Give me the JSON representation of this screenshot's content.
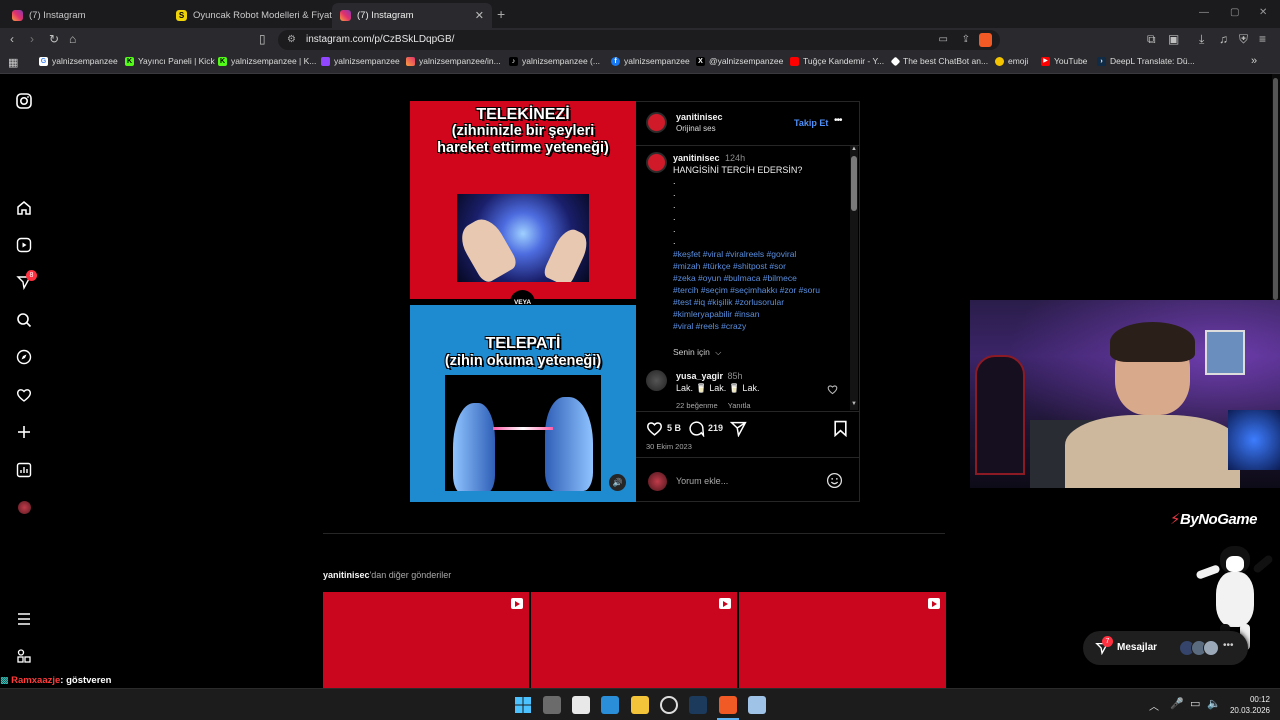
{
  "browser": {
    "tabs": [
      {
        "label": "(7) Instagram",
        "active": false
      },
      {
        "label": "Oyuncak Robot Modelleri & Fiyatları",
        "active": false
      },
      {
        "label": "(7) Instagram",
        "active": true
      }
    ],
    "url": "instagram.com/p/CzBSkLDqpGB/",
    "bookmarks": [
      "yalnizsempanzee",
      "Yayıncı Paneli | Kick",
      "yalnizsempanzee | K...",
      "yalnizsempanzee",
      "yalnizsempanzee/in...",
      "yalnizsempanzee (...",
      "yalnizsempanzee",
      "@yalnizsempanzee",
      "Tuğçe Kandemir - Y...",
      "The best ChatBot an...",
      "emoji",
      "YouTube",
      "DeepL Translate: Dü..."
    ]
  },
  "sidebar": {
    "notification_count": "8"
  },
  "post": {
    "image": {
      "top_title": "TELEKİNEZİ",
      "top_subtitle": "(zihninizle bir şeyleri hareket ettirme yeteneği)",
      "divider": "VEYA",
      "bottom_title": "TELEPATİ",
      "bottom_subtitle": "(zihin okuma yeteneği)"
    },
    "header": {
      "username": "yanitinisec",
      "audio": "Orijinal ses",
      "follow_label": "Takip Et",
      "more": "•••"
    },
    "caption": {
      "username": "yanitinisec",
      "time": "124h",
      "text": "HANGİSİNİ TERCİH EDERSİN?",
      "dots": [
        ".",
        ".",
        ".",
        ".",
        ".",
        "."
      ],
      "hashtags": [
        "#keşfet #viral #viralreels #goviral",
        "#mizah #türkçe #shitpost #sor",
        "#zeka #oyun #bulmaca #bilmece",
        "#tercih #seçim #seçimhakkı #zor #soru",
        "#test #iq #kişilik #zorlusorular",
        "#kimleryapabilir #insan",
        "#viral #reels #crazy"
      ]
    },
    "sort_label": "Senin için",
    "comment": {
      "username": "yusa_yagir",
      "time": "85h",
      "text": "Lak. 🥛 Lak. 🥛 Lak.",
      "likes": "22 beğenme",
      "reply": "Yanıtla"
    },
    "actions": {
      "likes": "5 B",
      "comments": "219"
    },
    "date": "30 Ekim 2023",
    "comment_placeholder": "Yorum ekle..."
  },
  "more_posts": {
    "username": "yanitinisec",
    "label": "'dan diğer gönderiler"
  },
  "overlay": {
    "brand": "ByNoGame",
    "messages_label": "Mesajlar",
    "messages_count": "7",
    "chat_user": "Ramxaazje",
    "chat_text": ": göstveren"
  },
  "taskbar": {
    "time": "00:12",
    "date": "20.03.2026"
  }
}
